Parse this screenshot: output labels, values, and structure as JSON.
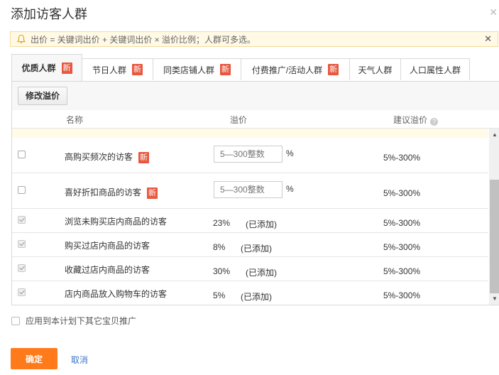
{
  "dialog": {
    "title": "添加访客人群"
  },
  "notice": {
    "text": "出价 = 关键词出价 + 关键词出价 × 溢价比例；人群可多选。"
  },
  "tabs": [
    {
      "label": "优质人群",
      "badge": "新",
      "active": true
    },
    {
      "label": "节日人群",
      "badge": "新"
    },
    {
      "label": "同类店铺人群",
      "badge": "新"
    },
    {
      "label": "付费推广/活动人群",
      "badge": "新"
    },
    {
      "label": "天气人群"
    },
    {
      "label": "人口属性人群"
    }
  ],
  "toolbar": {
    "modify_label": "修改溢价"
  },
  "table": {
    "headers": {
      "name": "名称",
      "premium": "溢价",
      "suggested": "建议溢价"
    },
    "rows": [
      {
        "name": "高购买频次的访客",
        "badge": "新",
        "checked": false,
        "placeholder": "5—300整数",
        "unit": "%",
        "suggested": "5%-300%"
      },
      {
        "name": "喜好折扣商品的访客",
        "badge": "新",
        "checked": false,
        "placeholder": "5—300整数",
        "unit": "%",
        "suggested": "5%-300%"
      },
      {
        "name": "浏览未购买店内商品的访客",
        "checked": true,
        "value": "23%",
        "added": "(已添加)",
        "suggested": "5%-300%"
      },
      {
        "name": "购买过店内商品的访客",
        "checked": true,
        "value": "8%",
        "added": "(已添加)",
        "suggested": "5%-300%"
      },
      {
        "name": "收藏过店内商品的访客",
        "checked": true,
        "value": "30%",
        "added": "(已添加)",
        "suggested": "5%-300%"
      },
      {
        "name": "店内商品放入购物车的访客",
        "checked": true,
        "value": "5%",
        "added": "(已添加)",
        "suggested": "5%-300%"
      }
    ]
  },
  "apply": {
    "label": "应用到本计划下其它宝贝推广"
  },
  "footer": {
    "ok_label": "确定",
    "cancel_label": "取消"
  },
  "colors": {
    "accent": "#ff7a1a",
    "badge": "#e8573f",
    "link": "#3b77c9",
    "notice_bg": "#fff9e6"
  }
}
